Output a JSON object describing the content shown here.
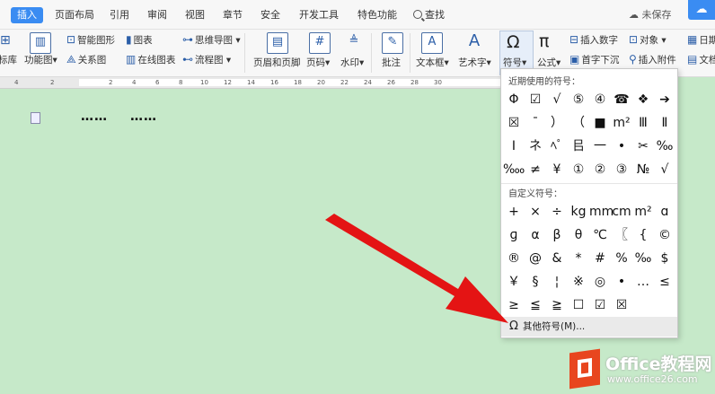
{
  "tabs": [
    "插入",
    "页面布局",
    "引用",
    "审阅",
    "视图",
    "章节",
    "安全",
    "开发工具",
    "特色功能"
  ],
  "search_label": "查找",
  "unsaved_label": "未保存",
  "ribbon": {
    "left_cut_1": "标库",
    "left_cut_2": "功能图",
    "smart_graphic": "智能图形",
    "chart": "图表",
    "mindmap": "思维导图",
    "relation": "关系图",
    "online_chart": "在线图表",
    "flowchart": "流程图",
    "header_footer": "页眉和页脚",
    "page_number": "页码",
    "watermark": "水印",
    "annotation": "批注",
    "textbox": "文本框",
    "wordart": "艺术字",
    "symbol": "符号",
    "formula": "公式",
    "insert_number": "插入数字",
    "object": "对象",
    "dropcap": "首字下沉",
    "attachment": "插入附件",
    "date": "日期",
    "doc_cut": "文档"
  },
  "ruler_ticks": [
    "4",
    "2",
    "2",
    "4",
    "6",
    "8",
    "10",
    "12",
    "14",
    "16",
    "18",
    "20",
    "22",
    "24",
    "26",
    "28",
    "30"
  ],
  "doc_dots": [
    "……",
    "……"
  ],
  "dropdown": {
    "recent_title": "近期使用的符号：",
    "recent_symbols": [
      "Φ",
      "☑",
      "√",
      "⑤",
      "④",
      "☎",
      "❖",
      "➔",
      "☒",
      "¯",
      "）",
      "（",
      "■",
      "m²",
      "Ⅲ",
      "Ⅱ",
      "Ⅰ",
      "ネ",
      "ﾍﾟ",
      "㠯",
      "一",
      "•",
      "✂",
      "‰",
      "‱",
      "≠",
      "¥",
      "①",
      "②",
      "③",
      "№",
      "√"
    ],
    "custom_title": "自定义符号：",
    "custom_symbols": [
      "+",
      "×",
      "÷",
      "kg",
      "mm",
      "cm",
      "m²",
      "ɑ",
      "ɡ",
      "α",
      "β",
      "θ",
      "℃",
      "〖",
      "{",
      "©",
      "®",
      "@",
      "&",
      "*",
      "#",
      "%",
      "‰",
      "$",
      "￥",
      "§",
      "¦",
      "※",
      "◎",
      "•",
      "…",
      "≤",
      "≥",
      "≦",
      "≧",
      "☐",
      "☑",
      "☒",
      "",
      ""
    ],
    "more_label": "其他符号(M)..."
  },
  "logo": {
    "brand": "Office教程网",
    "url": "www.office26.com"
  },
  "colors": {
    "accent": "#3a8cf2",
    "doc_bg": "#c6e9c9",
    "arrow": "#e41414",
    "logo_red": "#e8461f"
  }
}
